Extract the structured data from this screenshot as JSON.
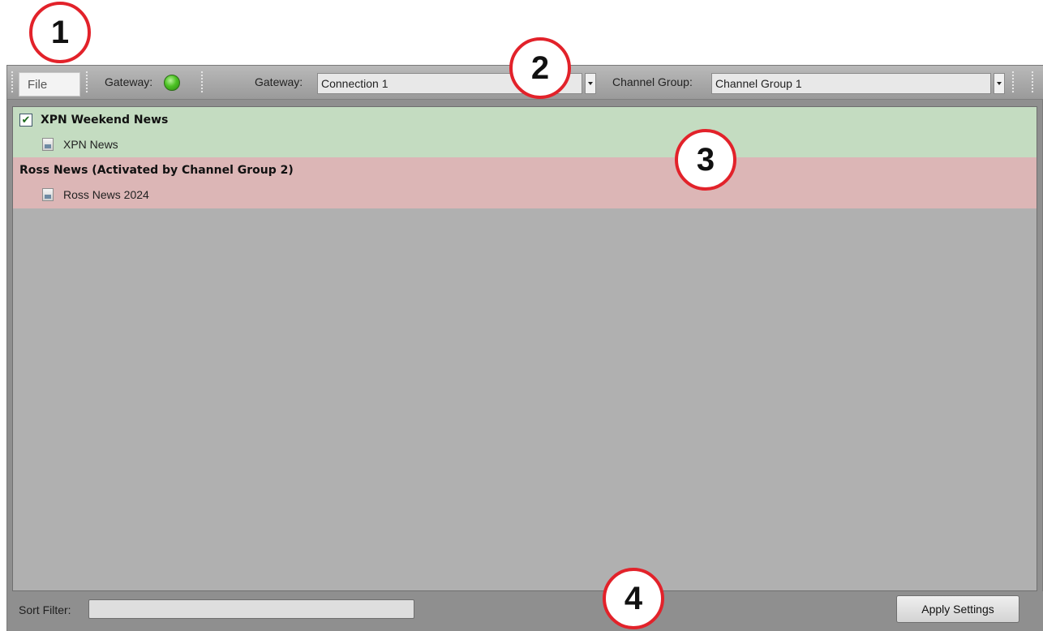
{
  "callouts": [
    "1",
    "2",
    "3",
    "4"
  ],
  "toolbar": {
    "file_label": "File",
    "gateway_status_label": "Gateway:",
    "gateway_status_color": "#4cc224",
    "gateway_label": "Gateway:",
    "gateway_value": "Connection 1",
    "channel_group_label": "Channel Group:",
    "channel_group_value": "Channel Group 1"
  },
  "groups": [
    {
      "title": "XPN Weekend News",
      "checked": true,
      "color": "#c4dcc1",
      "items": [
        "XPN News"
      ]
    },
    {
      "title": "Ross News (Activated by Channel Group 2)",
      "checked": false,
      "color": "#dcb6b6",
      "items": [
        "Ross News 2024"
      ]
    }
  ],
  "bottom": {
    "sort_filter_label": "Sort Filter:",
    "sort_filter_value": "",
    "apply_button_label": "Apply Settings"
  }
}
